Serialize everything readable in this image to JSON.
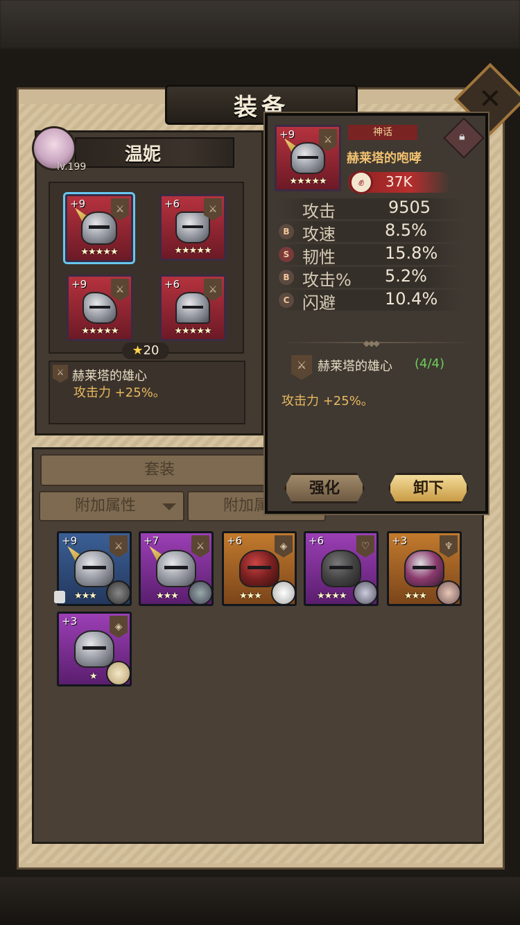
{
  "window": {
    "title": "装备",
    "close_label": "✕"
  },
  "hero": {
    "name": "温妮",
    "level": "lv.199",
    "star_total": "20"
  },
  "hero_slots": [
    {
      "enhance": "+9",
      "stars": "★★★★★",
      "selected": true
    },
    {
      "enhance": "+6",
      "stars": "★★★★★",
      "selected": false
    },
    {
      "enhance": "+9",
      "stars": "★★★★★",
      "selected": false
    },
    {
      "enhance": "+6",
      "stars": "★★★★★",
      "selected": false
    }
  ],
  "hero_set": {
    "name": "赫莱塔的雄心",
    "effect": "攻击力 +25%。"
  },
  "inventory": {
    "tab_set": "套装",
    "filter1": "附加属性",
    "filter2": "附加属",
    "items": [
      {
        "enhance": "+9",
        "stars": "★★★",
        "rarity": "blue"
      },
      {
        "enhance": "+7",
        "stars": "★★★",
        "rarity": "purple"
      },
      {
        "enhance": "+6",
        "stars": "★★★",
        "rarity": "orange"
      },
      {
        "enhance": "+6",
        "stars": "★★★★",
        "rarity": "purple"
      },
      {
        "enhance": "+3",
        "stars": "★★★",
        "rarity": "orange"
      },
      {
        "enhance": "+3",
        "stars": "★",
        "rarity": "purple"
      }
    ]
  },
  "popup": {
    "enhance": "+9",
    "stars": "★★★★★",
    "rarity": "神话",
    "name": "赫莱塔的咆哮",
    "power": "37K",
    "stats": [
      {
        "grade": "",
        "label": "攻击",
        "value": "9505"
      },
      {
        "grade": "B",
        "label": "攻速",
        "value": "8.5%"
      },
      {
        "grade": "S",
        "label": "韧性",
        "value": "15.8%"
      },
      {
        "grade": "B",
        "label": "攻击%",
        "value": "5.2%"
      },
      {
        "grade": "C",
        "label": "闪避",
        "value": "10.4%"
      }
    ],
    "set_name": "赫莱塔的雄心",
    "set_count": "(4/4)",
    "set_effect": "攻击力 +25%。",
    "btn_enhance": "强化",
    "btn_unequip": "卸下"
  },
  "colors": {
    "accent_gold": "#e9b95f",
    "set_complete": "#6fce5a",
    "rarity_mythic": "#7a2323"
  }
}
